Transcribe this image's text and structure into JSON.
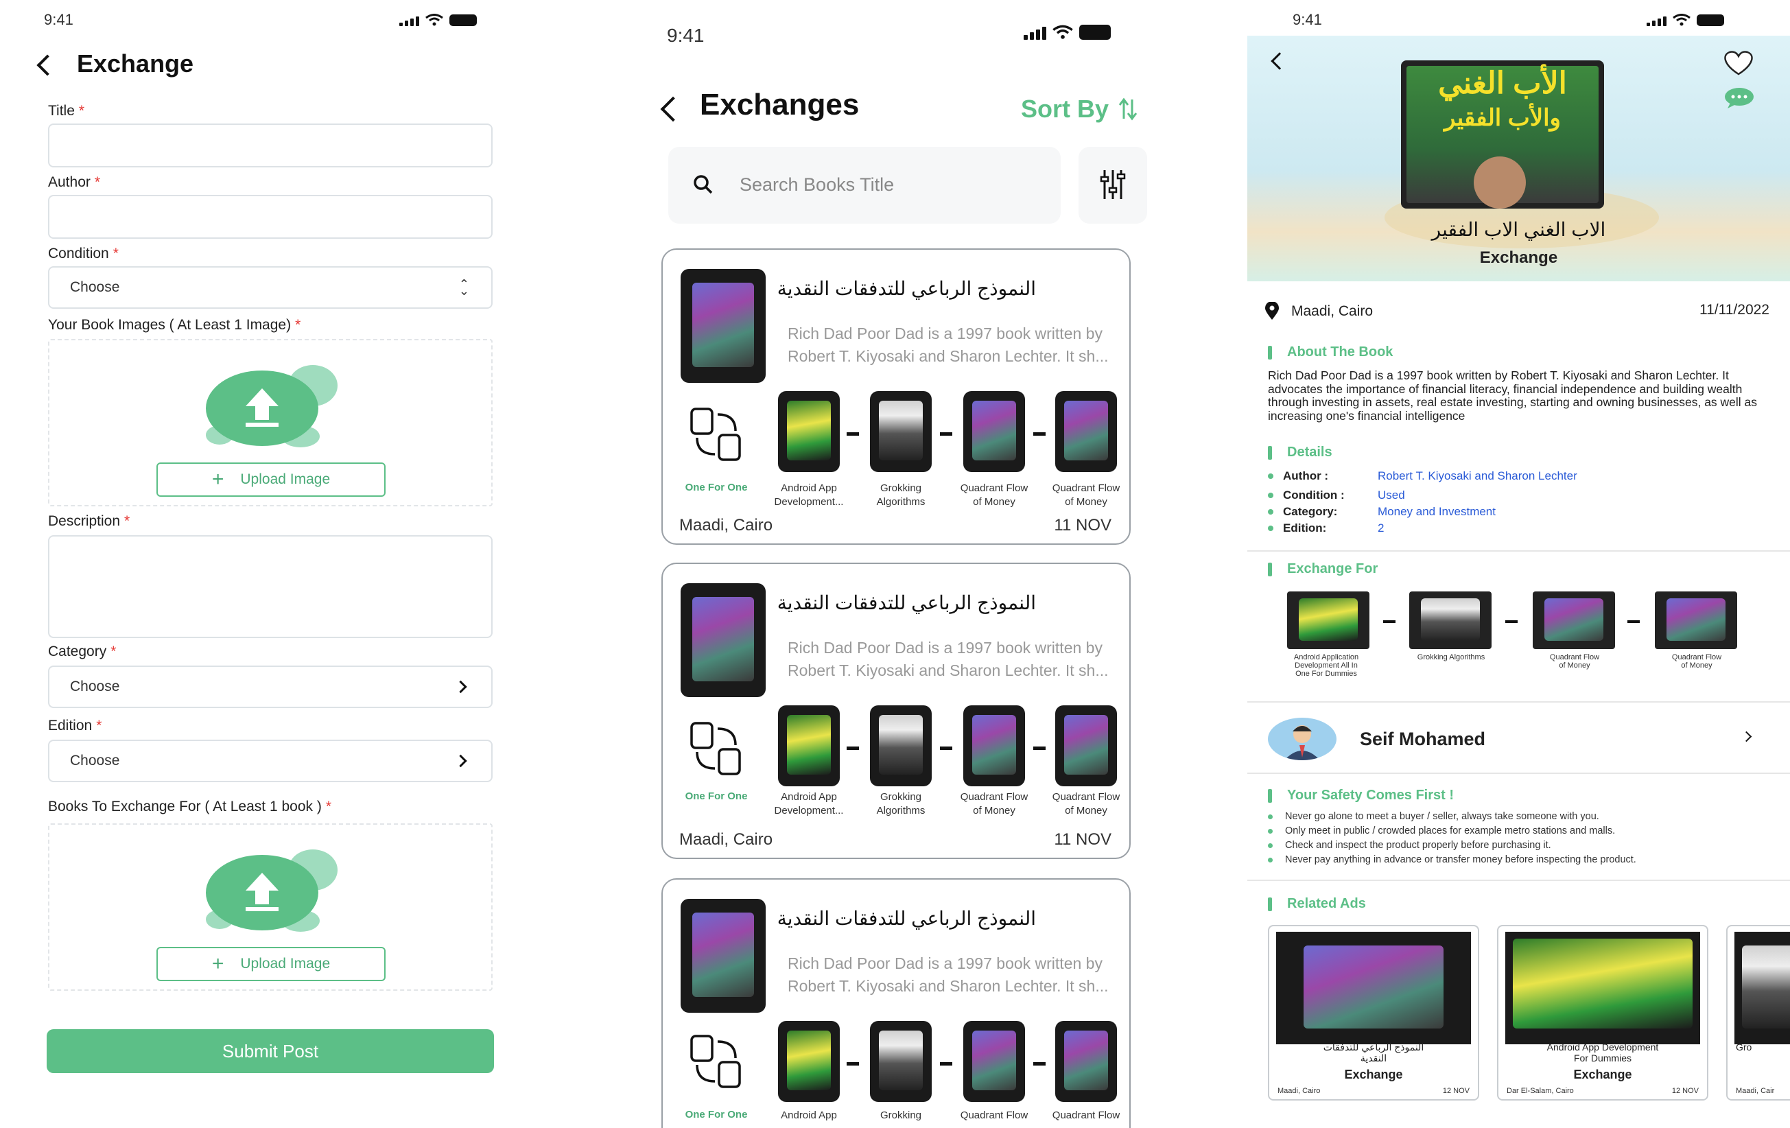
{
  "status_time": "9:41",
  "colors": {
    "accent": "#5cbf87",
    "required": "#e53935",
    "link": "#2a5bd7"
  },
  "form": {
    "title": "Exchange",
    "title_label": "Title",
    "author_label": "Author",
    "condition_label": "Condition",
    "condition_value": "Choose",
    "images_label": "Your Book Images ( At Least 1 Image)",
    "upload_label": "Upload Image",
    "description_label": "Description",
    "category_label": "Category",
    "category_value": "Choose",
    "edition_label": "Edition",
    "edition_value": "Choose",
    "exchange_books_label": "Books To Exchange For ( At Least 1 book )",
    "required_mark": "*",
    "submit_label": "Submit Post"
  },
  "list": {
    "title": "Exchanges",
    "sort_label": "Sort By",
    "search_placeholder": "Search Books Title",
    "swap_label": "One For One",
    "cards": [
      {
        "title": "النموذج الرباعي للتدفقات النقدية",
        "desc_line1": "Rich Dad Poor Dad is a 1997 book written by",
        "desc_line2": "Robert T. Kiyosaki and Sharon Lechter. It sh...",
        "books": [
          {
            "line1": "Android App",
            "line2": "Development..."
          },
          {
            "line1": "Grokking",
            "line2": "Algorithms"
          },
          {
            "line1": "Quadrant Flow",
            "line2": "of Money"
          },
          {
            "line1": "Quadrant Flow",
            "line2": "of Money"
          }
        ],
        "location": "Maadi, Cairo",
        "date": "11 NOV"
      },
      {
        "title": "النموذج الرباعي للتدفقات النقدية",
        "desc_line1": "Rich Dad Poor Dad is a 1997 book written by",
        "desc_line2": "Robert T. Kiyosaki and Sharon Lechter. It sh...",
        "books": [
          {
            "line1": "Android App",
            "line2": "Development..."
          },
          {
            "line1": "Grokking",
            "line2": "Algorithms"
          },
          {
            "line1": "Quadrant Flow",
            "line2": "of Money"
          },
          {
            "line1": "Quadrant Flow",
            "line2": "of Money"
          }
        ],
        "location": "Maadi, Cairo",
        "date": "11 NOV"
      },
      {
        "title": "النموذج الرباعي للتدفقات النقدية",
        "desc_line1": "Rich Dad Poor Dad is a 1997 book written by",
        "desc_line2": "Robert T. Kiyosaki and Sharon Lechter. It sh...",
        "books": [
          {
            "line1": "Android App",
            "line2": ""
          },
          {
            "line1": "Grokking",
            "line2": ""
          },
          {
            "line1": "Quadrant Flow",
            "line2": ""
          },
          {
            "line1": "Quadrant Flow",
            "line2": ""
          }
        ]
      }
    ]
  },
  "detail": {
    "cover_text_1": "الأب الغني",
    "cover_text_2": "والأب الفقير",
    "book_title": "الاب الغني الاب الفقير",
    "type_label": "Exchange",
    "location": "Maadi, Cairo",
    "date": "11/11/2022",
    "about_heading": "About The Book",
    "about_text": "Rich Dad Poor Dad is a 1997 book written by Robert T. Kiyosaki and Sharon Lechter. It advocates the importance of financial literacy, financial independence and building wealth through investing in assets, real estate investing, starting and owning businesses, as well as increasing one's financial intelligence",
    "details_heading": "Details",
    "details": [
      {
        "key": "Author :",
        "value": "Robert T. Kiyosaki and Sharon Lechter"
      },
      {
        "key": "Condition :",
        "value": "Used"
      },
      {
        "key": "Category:",
        "value": "Money and Investment"
      },
      {
        "key": "Edition:",
        "value": "2"
      }
    ],
    "exchange_heading": "Exchange For",
    "exchange_books": [
      {
        "line1": "Android Application",
        "line2": "Development All In",
        "line3": "One For Dummies"
      },
      {
        "line1": "Grokking Algorithms",
        "line2": "",
        "line3": ""
      },
      {
        "line1": "Quadrant Flow",
        "line2": "of Money",
        "line3": ""
      },
      {
        "line1": "Quadrant Flow",
        "line2": "of Money",
        "line3": ""
      }
    ],
    "seller_name": "Seif Mohamed",
    "safety_heading": "Your Safety Comes First !",
    "safety_tips": [
      "Never go alone to meet a buyer / seller, always take someone with you.",
      "Only meet in public / crowded places for example metro stations and malls.",
      "Check and inspect the product properly before purchasing it.",
      "Never pay anything in advance or transfer money before inspecting the product."
    ],
    "related_heading": "Related Ads",
    "related": [
      {
        "title1": "النموذج الرباعي للتدفقات",
        "title2": "النقدية",
        "type": "Exchange",
        "location": "Maadi, Cairo",
        "date": "12 NOV"
      },
      {
        "title1": "Android App Development",
        "title2": "For Dummies",
        "type": "Exchange",
        "location": "Dar El-Salam, Cairo",
        "date": "12 NOV"
      },
      {
        "title1": "Gro",
        "title2": "",
        "type": "",
        "location": "Maadi, Cair",
        "date": ""
      }
    ]
  }
}
